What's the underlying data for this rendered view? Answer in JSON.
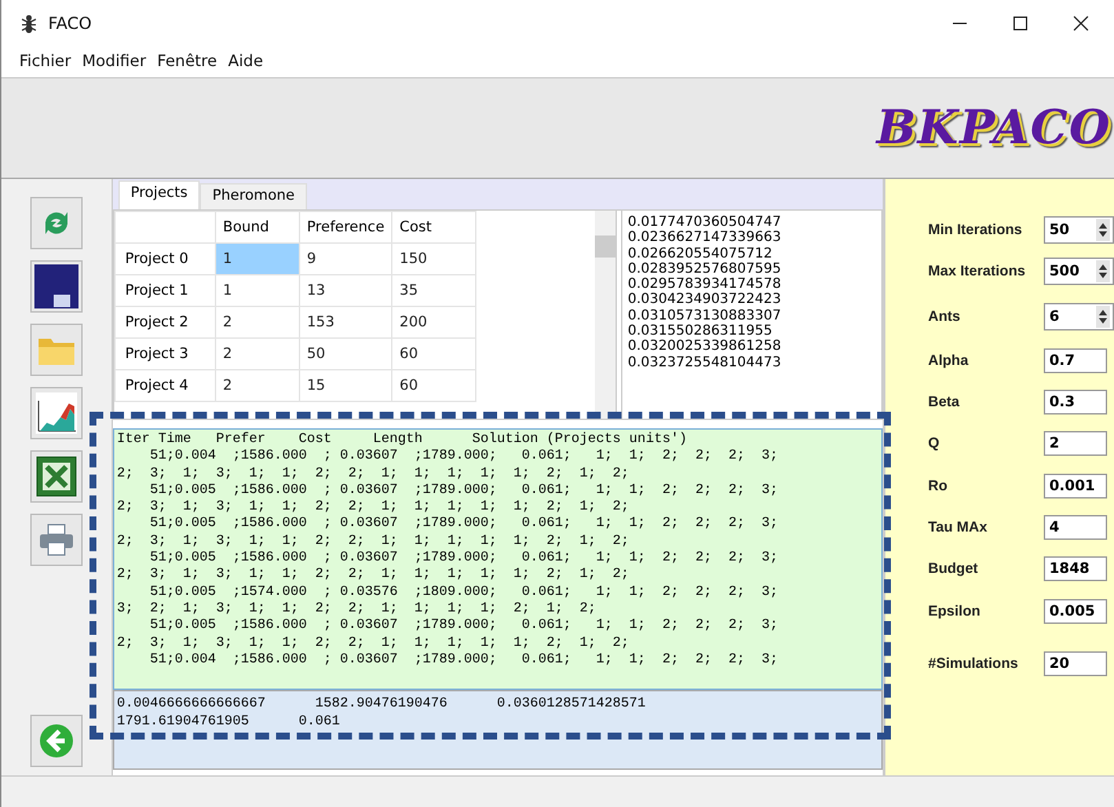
{
  "window": {
    "title": "FACO"
  },
  "menu": [
    "Fichier",
    "Modifier",
    "Fenêtre",
    "Aide"
  ],
  "logo": "BKPACO",
  "tabs": [
    {
      "label": "Projects",
      "selected": true
    },
    {
      "label": "Pheromone",
      "selected": false
    }
  ],
  "table": {
    "columns": [
      "",
      "Bound",
      "Preference",
      "Cost"
    ],
    "rows": [
      {
        "cells": [
          {
            "text": "Project 0",
            "kind": "header",
            "selected": false
          },
          {
            "text": "1",
            "kind": "data",
            "selected": true
          },
          {
            "text": "9",
            "selected": false
          },
          {
            "text": "150",
            "selected": false
          }
        ]
      },
      {
        "cells": [
          {
            "text": "Project 1",
            "kind": "header",
            "selected": false
          },
          {
            "text": "1",
            "selected": false
          },
          {
            "text": "13",
            "selected": false
          },
          {
            "text": "35",
            "selected": false
          }
        ]
      },
      {
        "cells": [
          {
            "text": "Project 2",
            "kind": "header",
            "selected": false
          },
          {
            "text": "2",
            "selected": false
          },
          {
            "text": "153",
            "selected": false
          },
          {
            "text": "200",
            "selected": false
          }
        ]
      },
      {
        "cells": [
          {
            "text": "Project 3",
            "kind": "header",
            "selected": false
          },
          {
            "text": "2",
            "selected": false
          },
          {
            "text": "50",
            "selected": false
          },
          {
            "text": "60",
            "selected": false
          }
        ]
      },
      {
        "cells": [
          {
            "text": "Project 4",
            "kind": "header",
            "selected": false
          },
          {
            "text": "2",
            "selected": false
          },
          {
            "text": "15",
            "selected": false
          },
          {
            "text": "60",
            "selected": false
          }
        ]
      }
    ]
  },
  "values_list": [
    "0.0177470360504747",
    "0.0236627147339663",
    "0.026620554075712",
    "0.0283952576807595",
    "0.0295783934174578",
    "0.0304234903722423",
    "0.0310573130883307",
    "0.031550286311955",
    "0.0320025339861258",
    "0.0323725548104473"
  ],
  "log": [
    "Iter Time   Prefer    Cost     Length      Solution (Projects units')",
    "    51;0.004  ;1586.000  ; 0.03607  ;1789.000;   0.061;   1;  1;  2;  2;  2;  3;",
    "2;  3;  1;  3;  1;  1;  2;  2;  1;  1;  1;  1;  1;  2;  1;  2;",
    "    51;0.005  ;1586.000  ; 0.03607  ;1789.000;   0.061;   1;  1;  2;  2;  2;  3;",
    "2;  3;  1;  3;  1;  1;  2;  2;  1;  1;  1;  1;  1;  2;  1;  2;",
    "    51;0.005  ;1586.000  ; 0.03607  ;1789.000;   0.061;   1;  1;  2;  2;  2;  3;",
    "2;  3;  1;  3;  1;  1;  2;  2;  1;  1;  1;  1;  1;  2;  1;  2;",
    "    51;0.005  ;1586.000  ; 0.03607  ;1789.000;   0.061;   1;  1;  2;  2;  2;  3;",
    "2;  3;  1;  3;  1;  1;  2;  2;  1;  1;  1;  1;  1;  2;  1;  2;",
    "    51;0.005  ;1574.000  ; 0.03576  ;1809.000;   0.061;   1;  1;  2;  2;  2;  3;",
    "3;  2;  1;  3;  1;  1;  2;  2;  1;  1;  1;  1;  2;  1;  2;",
    "    51;0.005  ;1586.000  ; 0.03607  ;1789.000;   0.061;   1;  1;  2;  2;  2;  3;",
    "2;  3;  1;  3;  1;  1;  2;  2;  1;  1;  1;  1;  1;  2;  1;  2;",
    "    51;0.004  ;1586.000  ; 0.03607  ;1789.000;   0.061;   1;  1;  2;  2;  2;  3;"
  ],
  "result": [
    "0.0046666666666667      1582.90476190476      0.0360128571428571",
    "1791.61904761905      0.061"
  ],
  "parameters": [
    {
      "label": "Min Iterations",
      "value": "50",
      "kind": "spinner"
    },
    {
      "label": "Max Iterations",
      "value": "500",
      "kind": "spinner"
    },
    {
      "label": "Ants",
      "value": "6",
      "kind": "spinner"
    },
    {
      "label": "Alpha",
      "value": "0.7",
      "kind": "text"
    },
    {
      "label": "Beta",
      "value": "0.3",
      "kind": "text"
    },
    {
      "label": "Q",
      "value": "2",
      "kind": "text"
    },
    {
      "label": "Ro",
      "value": "0.001",
      "kind": "text"
    },
    {
      "label": "Tau MAx",
      "value": "4",
      "kind": "text"
    },
    {
      "label": "Budget",
      "value": "1848",
      "kind": "text"
    },
    {
      "label": "Epsilon",
      "value": "0.005",
      "kind": "text"
    },
    {
      "label": "#Simulations",
      "value": "20",
      "kind": "text"
    }
  ]
}
